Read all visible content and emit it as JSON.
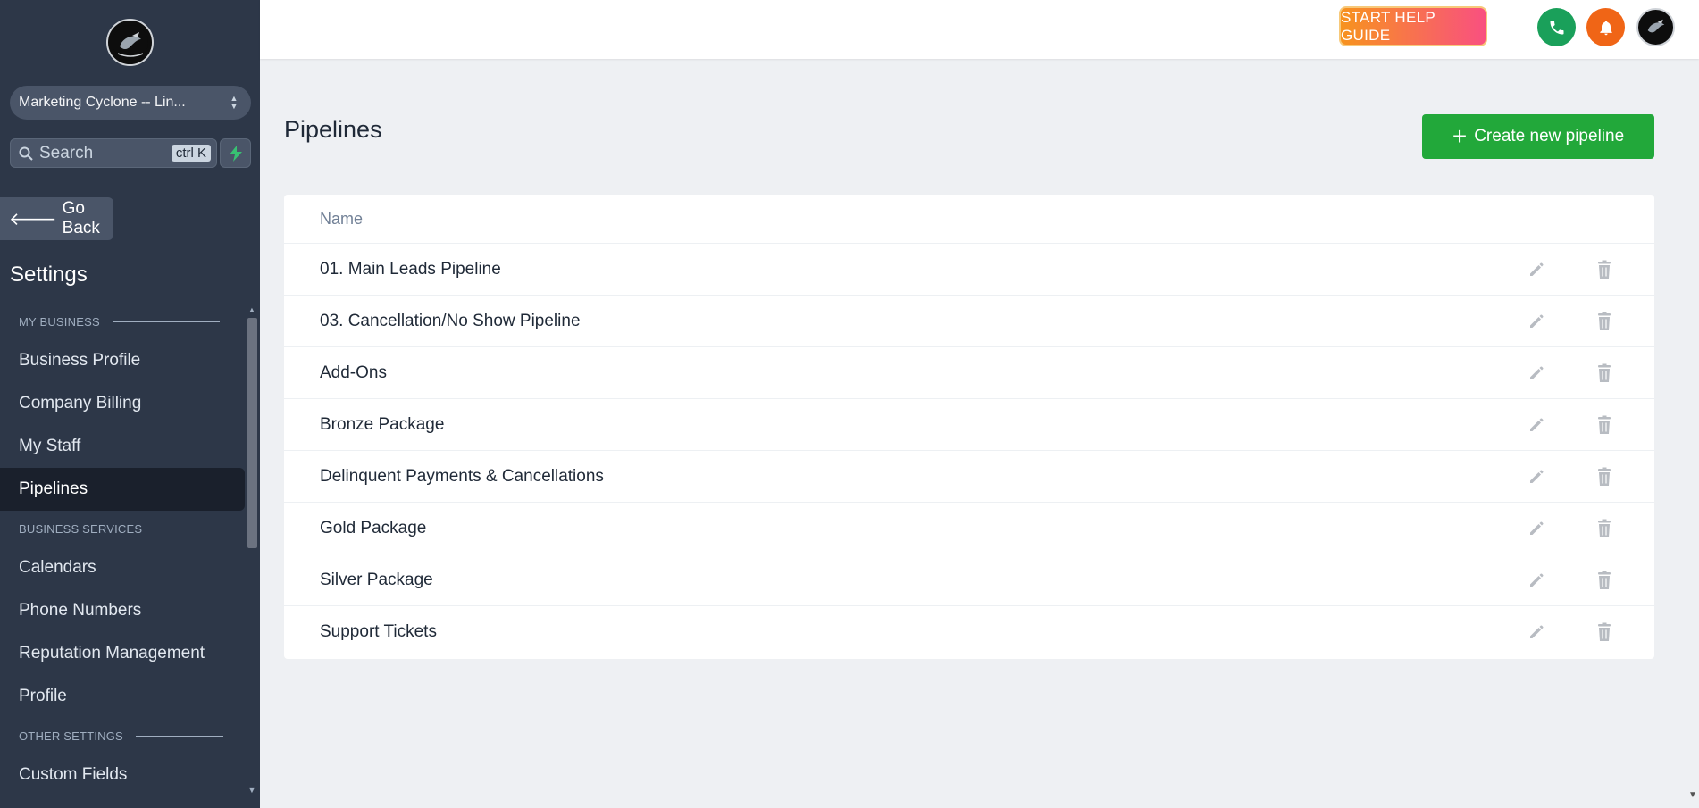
{
  "sidebar": {
    "account_name": "Marketing Cyclone -- Lin...",
    "search_placeholder": "Search",
    "search_shortcut": "ctrl K",
    "go_back_label": "Go Back",
    "settings_title": "Settings",
    "sections": {
      "my_business": "MY BUSINESS",
      "business_services": "BUSINESS SERVICES",
      "other_settings": "OTHER SETTINGS"
    },
    "items": {
      "business_profile": "Business Profile",
      "company_billing": "Company Billing",
      "my_staff": "My Staff",
      "pipelines": "Pipelines",
      "calendars": "Calendars",
      "phone_numbers": "Phone Numbers",
      "reputation_management": "Reputation Management",
      "profile": "Profile",
      "custom_fields": "Custom Fields"
    },
    "active_item": "pipelines"
  },
  "topbar": {
    "help_label": "START HELP GUIDE",
    "icons": [
      "phone-icon",
      "bell-icon",
      "avatar"
    ],
    "colors": {
      "phone": "#1aa05a",
      "bell": "#f06516",
      "help_start": "#f7931e",
      "help_end": "#f95080"
    }
  },
  "main": {
    "title": "Pipelines",
    "create_button_label": "Create new pipeline",
    "table": {
      "header": "Name",
      "rows": [
        "01. Main Leads Pipeline",
        "03. Cancellation/No Show Pipeline",
        "Add-Ons",
        "Bronze Package",
        "Delinquent Payments & Cancellations",
        "Gold Package",
        "Silver Package",
        "Support Tickets"
      ],
      "row_actions": [
        "edit-icon",
        "delete-icon"
      ]
    },
    "accent_color": "#22a83a"
  }
}
